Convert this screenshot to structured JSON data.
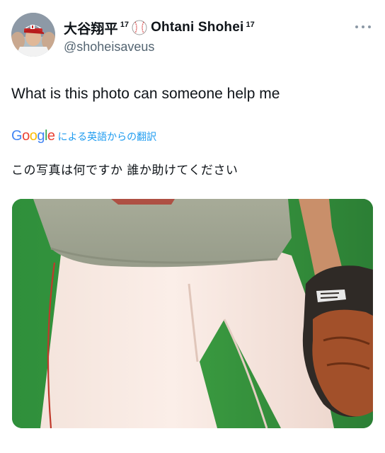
{
  "tweet": {
    "author": {
      "display_name": "大谷翔平",
      "display_sup": "17",
      "display_name_en": "Ohtani Shohei",
      "display_sup_en": "17",
      "handle": "@shoheisaveus",
      "badge_icon": "baseball-icon"
    },
    "more_icon": "more-options-icon",
    "text": "What is this photo can someone help me",
    "translate": {
      "logo_letters": [
        "G",
        "o",
        "o",
        "g",
        "l",
        "e"
      ],
      "label": "による英語からの翻訳"
    },
    "translated_text": "この写真は何ですか 誰か助けてください",
    "colors": {
      "link": "#1d9bf0",
      "secondary_text": "#536471",
      "primary_text": "#0f1419",
      "google_blue": "#4285f4",
      "google_red": "#ea4335",
      "google_yellow": "#fbbc05",
      "google_green": "#34a853"
    }
  }
}
